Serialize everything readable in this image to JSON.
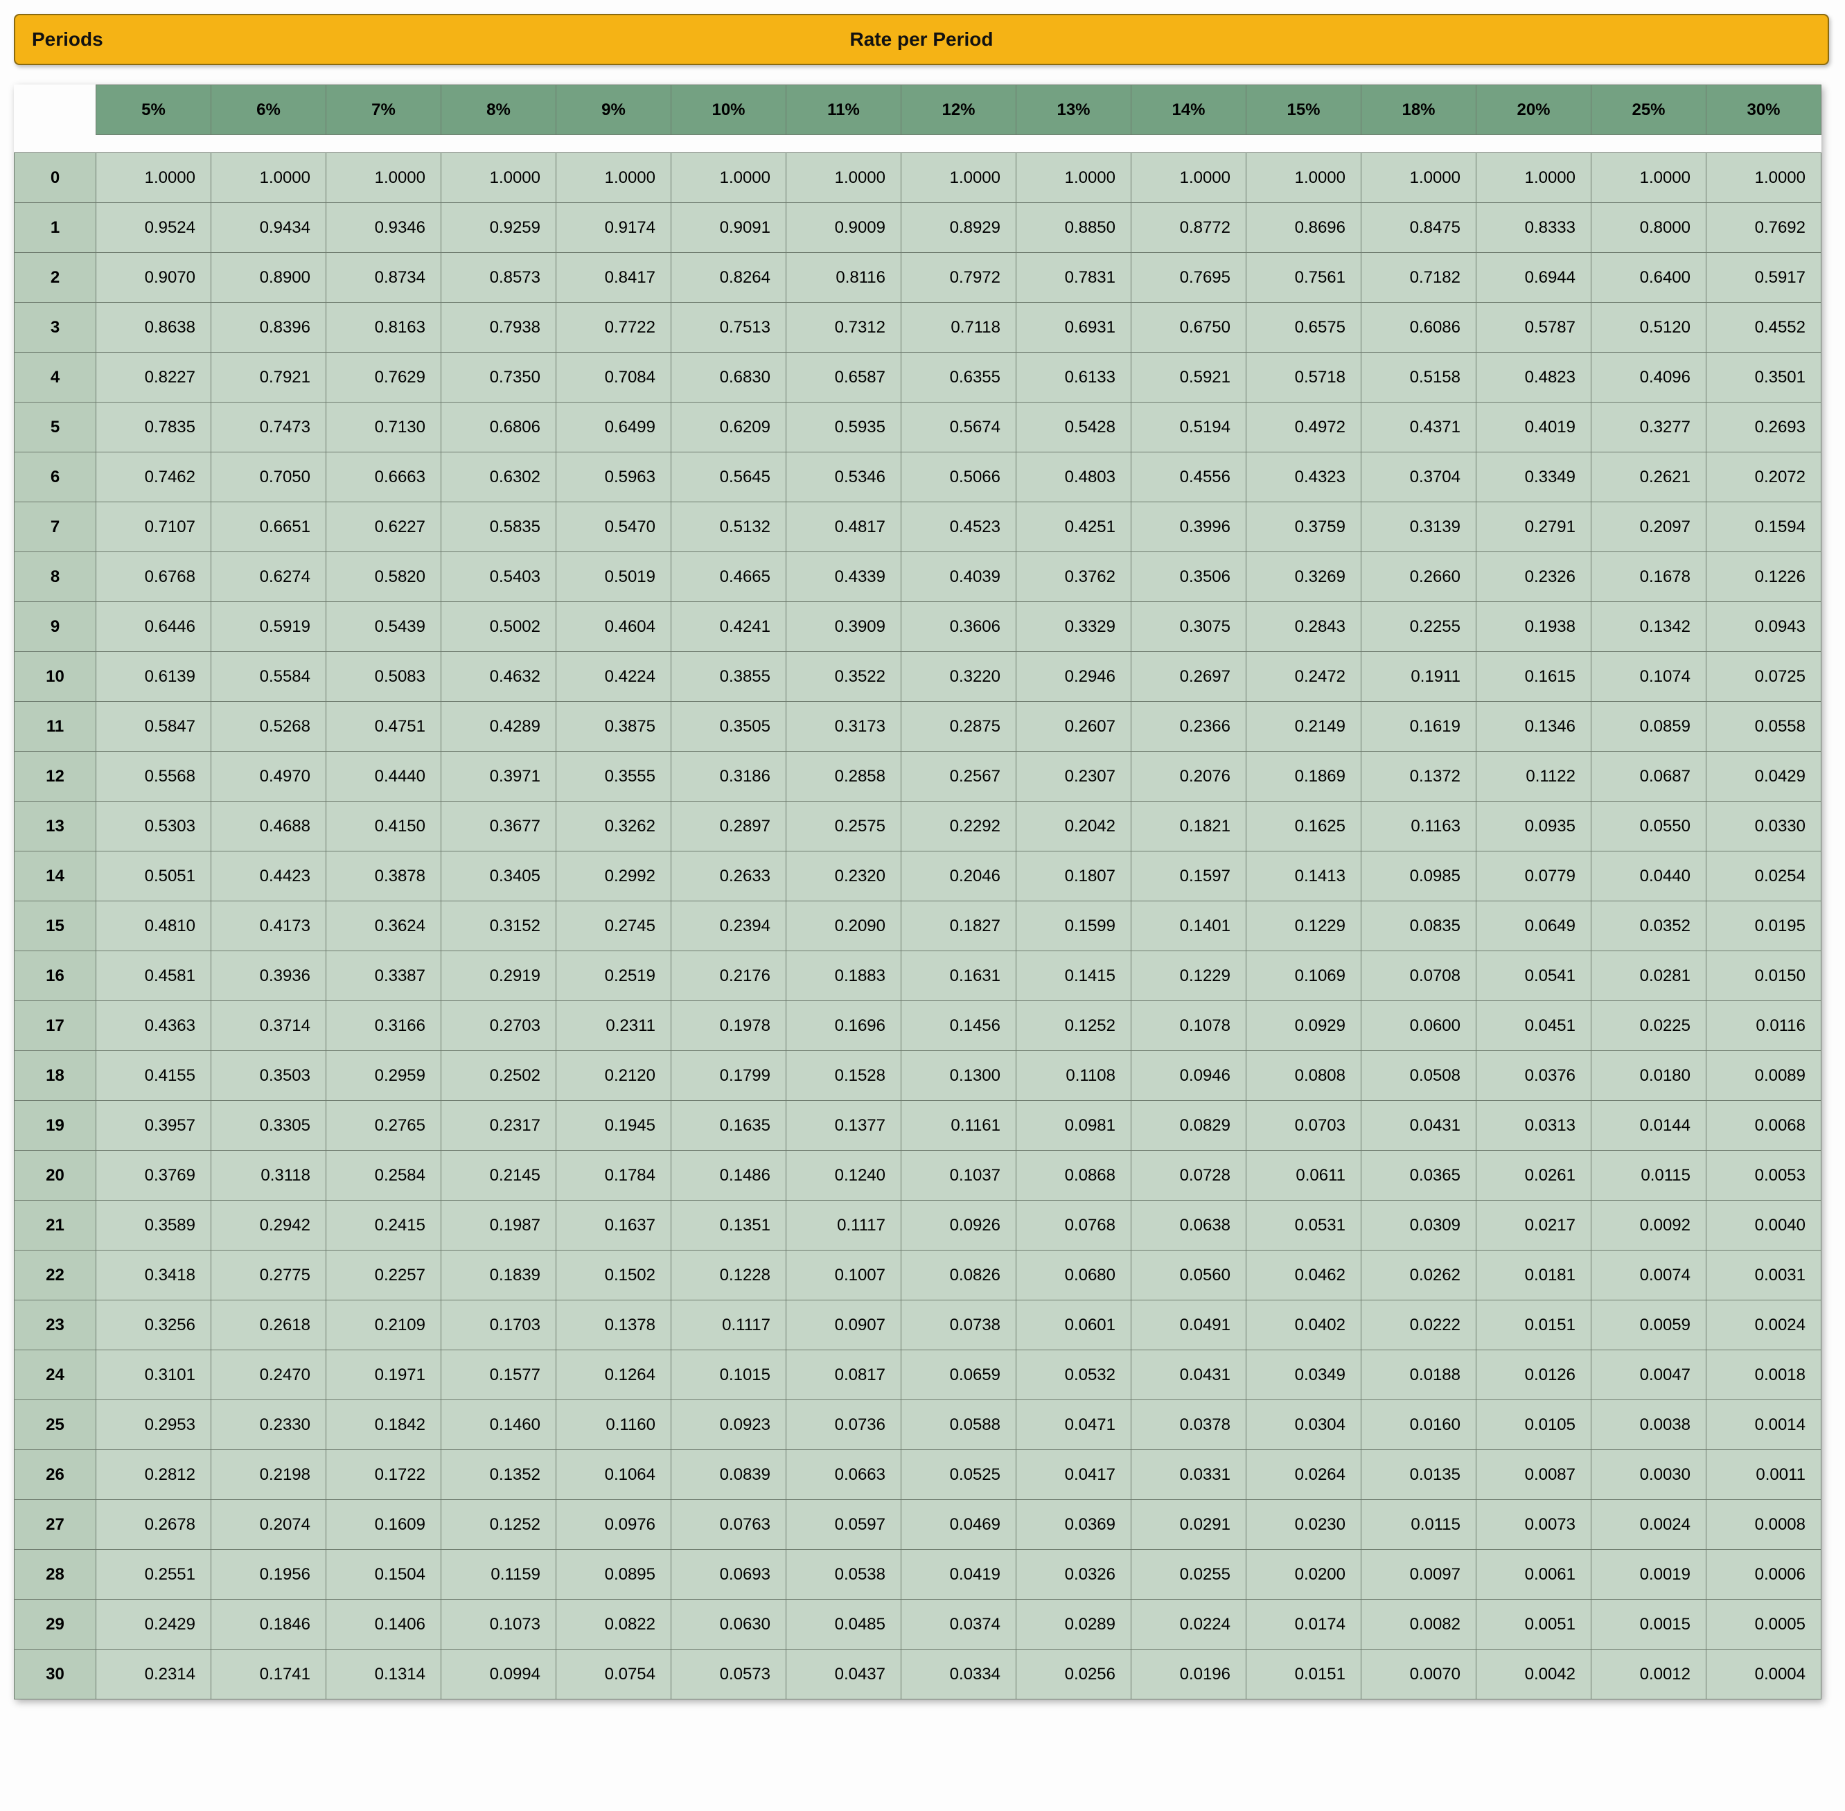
{
  "header": {
    "left": "Periods",
    "center": "Rate per Period"
  },
  "chart_data": {
    "type": "table",
    "title": "Present Value Factor Table",
    "columns": [
      "5%",
      "6%",
      "7%",
      "8%",
      "9%",
      "10%",
      "11%",
      "12%",
      "13%",
      "14%",
      "15%",
      "18%",
      "20%",
      "25%",
      "30%"
    ],
    "row_labels": [
      "0",
      "1",
      "2",
      "3",
      "4",
      "5",
      "6",
      "7",
      "8",
      "9",
      "10",
      "11",
      "12",
      "13",
      "14",
      "15",
      "16",
      "17",
      "18",
      "19",
      "20",
      "21",
      "22",
      "23",
      "24",
      "25",
      "26",
      "27",
      "28",
      "29",
      "30"
    ],
    "values": [
      [
        "1.0000",
        "1.0000",
        "1.0000",
        "1.0000",
        "1.0000",
        "1.0000",
        "1.0000",
        "1.0000",
        "1.0000",
        "1.0000",
        "1.0000",
        "1.0000",
        "1.0000",
        "1.0000",
        "1.0000"
      ],
      [
        "0.9524",
        "0.9434",
        "0.9346",
        "0.9259",
        "0.9174",
        "0.9091",
        "0.9009",
        "0.8929",
        "0.8850",
        "0.8772",
        "0.8696",
        "0.8475",
        "0.8333",
        "0.8000",
        "0.7692"
      ],
      [
        "0.9070",
        "0.8900",
        "0.8734",
        "0.8573",
        "0.8417",
        "0.8264",
        "0.8116",
        "0.7972",
        "0.7831",
        "0.7695",
        "0.7561",
        "0.7182",
        "0.6944",
        "0.6400",
        "0.5917"
      ],
      [
        "0.8638",
        "0.8396",
        "0.8163",
        "0.7938",
        "0.7722",
        "0.7513",
        "0.7312",
        "0.7118",
        "0.6931",
        "0.6750",
        "0.6575",
        "0.6086",
        "0.5787",
        "0.5120",
        "0.4552"
      ],
      [
        "0.8227",
        "0.7921",
        "0.7629",
        "0.7350",
        "0.7084",
        "0.6830",
        "0.6587",
        "0.6355",
        "0.6133",
        "0.5921",
        "0.5718",
        "0.5158",
        "0.4823",
        "0.4096",
        "0.3501"
      ],
      [
        "0.7835",
        "0.7473",
        "0.7130",
        "0.6806",
        "0.6499",
        "0.6209",
        "0.5935",
        "0.5674",
        "0.5428",
        "0.5194",
        "0.4972",
        "0.4371",
        "0.4019",
        "0.3277",
        "0.2693"
      ],
      [
        "0.7462",
        "0.7050",
        "0.6663",
        "0.6302",
        "0.5963",
        "0.5645",
        "0.5346",
        "0.5066",
        "0.4803",
        "0.4556",
        "0.4323",
        "0.3704",
        "0.3349",
        "0.2621",
        "0.2072"
      ],
      [
        "0.7107",
        "0.6651",
        "0.6227",
        "0.5835",
        "0.5470",
        "0.5132",
        "0.4817",
        "0.4523",
        "0.4251",
        "0.3996",
        "0.3759",
        "0.3139",
        "0.2791",
        "0.2097",
        "0.1594"
      ],
      [
        "0.6768",
        "0.6274",
        "0.5820",
        "0.5403",
        "0.5019",
        "0.4665",
        "0.4339",
        "0.4039",
        "0.3762",
        "0.3506",
        "0.3269",
        "0.2660",
        "0.2326",
        "0.1678",
        "0.1226"
      ],
      [
        "0.6446",
        "0.5919",
        "0.5439",
        "0.5002",
        "0.4604",
        "0.4241",
        "0.3909",
        "0.3606",
        "0.3329",
        "0.3075",
        "0.2843",
        "0.2255",
        "0.1938",
        "0.1342",
        "0.0943"
      ],
      [
        "0.6139",
        "0.5584",
        "0.5083",
        "0.4632",
        "0.4224",
        "0.3855",
        "0.3522",
        "0.3220",
        "0.2946",
        "0.2697",
        "0.2472",
        "0.1911",
        "0.1615",
        "0.1074",
        "0.0725"
      ],
      [
        "0.5847",
        "0.5268",
        "0.4751",
        "0.4289",
        "0.3875",
        "0.3505",
        "0.3173",
        "0.2875",
        "0.2607",
        "0.2366",
        "0.2149",
        "0.1619",
        "0.1346",
        "0.0859",
        "0.0558"
      ],
      [
        "0.5568",
        "0.4970",
        "0.4440",
        "0.3971",
        "0.3555",
        "0.3186",
        "0.2858",
        "0.2567",
        "0.2307",
        "0.2076",
        "0.1869",
        "0.1372",
        "0.1122",
        "0.0687",
        "0.0429"
      ],
      [
        "0.5303",
        "0.4688",
        "0.4150",
        "0.3677",
        "0.3262",
        "0.2897",
        "0.2575",
        "0.2292",
        "0.2042",
        "0.1821",
        "0.1625",
        "0.1163",
        "0.0935",
        "0.0550",
        "0.0330"
      ],
      [
        "0.5051",
        "0.4423",
        "0.3878",
        "0.3405",
        "0.2992",
        "0.2633",
        "0.2320",
        "0.2046",
        "0.1807",
        "0.1597",
        "0.1413",
        "0.0985",
        "0.0779",
        "0.0440",
        "0.0254"
      ],
      [
        "0.4810",
        "0.4173",
        "0.3624",
        "0.3152",
        "0.2745",
        "0.2394",
        "0.2090",
        "0.1827",
        "0.1599",
        "0.1401",
        "0.1229",
        "0.0835",
        "0.0649",
        "0.0352",
        "0.0195"
      ],
      [
        "0.4581",
        "0.3936",
        "0.3387",
        "0.2919",
        "0.2519",
        "0.2176",
        "0.1883",
        "0.1631",
        "0.1415",
        "0.1229",
        "0.1069",
        "0.0708",
        "0.0541",
        "0.0281",
        "0.0150"
      ],
      [
        "0.4363",
        "0.3714",
        "0.3166",
        "0.2703",
        "0.2311",
        "0.1978",
        "0.1696",
        "0.1456",
        "0.1252",
        "0.1078",
        "0.0929",
        "0.0600",
        "0.0451",
        "0.0225",
        "0.0116"
      ],
      [
        "0.4155",
        "0.3503",
        "0.2959",
        "0.2502",
        "0.2120",
        "0.1799",
        "0.1528",
        "0.1300",
        "0.1108",
        "0.0946",
        "0.0808",
        "0.0508",
        "0.0376",
        "0.0180",
        "0.0089"
      ],
      [
        "0.3957",
        "0.3305",
        "0.2765",
        "0.2317",
        "0.1945",
        "0.1635",
        "0.1377",
        "0.1161",
        "0.0981",
        "0.0829",
        "0.0703",
        "0.0431",
        "0.0313",
        "0.0144",
        "0.0068"
      ],
      [
        "0.3769",
        "0.3118",
        "0.2584",
        "0.2145",
        "0.1784",
        "0.1486",
        "0.1240",
        "0.1037",
        "0.0868",
        "0.0728",
        "0.0611",
        "0.0365",
        "0.0261",
        "0.0115",
        "0.0053"
      ],
      [
        "0.3589",
        "0.2942",
        "0.2415",
        "0.1987",
        "0.1637",
        "0.1351",
        "0.1117",
        "0.0926",
        "0.0768",
        "0.0638",
        "0.0531",
        "0.0309",
        "0.0217",
        "0.0092",
        "0.0040"
      ],
      [
        "0.3418",
        "0.2775",
        "0.2257",
        "0.1839",
        "0.1502",
        "0.1228",
        "0.1007",
        "0.0826",
        "0.0680",
        "0.0560",
        "0.0462",
        "0.0262",
        "0.0181",
        "0.0074",
        "0.0031"
      ],
      [
        "0.3256",
        "0.2618",
        "0.2109",
        "0.1703",
        "0.1378",
        "0.1117",
        "0.0907",
        "0.0738",
        "0.0601",
        "0.0491",
        "0.0402",
        "0.0222",
        "0.0151",
        "0.0059",
        "0.0024"
      ],
      [
        "0.3101",
        "0.2470",
        "0.1971",
        "0.1577",
        "0.1264",
        "0.1015",
        "0.0817",
        "0.0659",
        "0.0532",
        "0.0431",
        "0.0349",
        "0.0188",
        "0.0126",
        "0.0047",
        "0.0018"
      ],
      [
        "0.2953",
        "0.2330",
        "0.1842",
        "0.1460",
        "0.1160",
        "0.0923",
        "0.0736",
        "0.0588",
        "0.0471",
        "0.0378",
        "0.0304",
        "0.0160",
        "0.0105",
        "0.0038",
        "0.0014"
      ],
      [
        "0.2812",
        "0.2198",
        "0.1722",
        "0.1352",
        "0.1064",
        "0.0839",
        "0.0663",
        "0.0525",
        "0.0417",
        "0.0331",
        "0.0264",
        "0.0135",
        "0.0087",
        "0.0030",
        "0.0011"
      ],
      [
        "0.2678",
        "0.2074",
        "0.1609",
        "0.1252",
        "0.0976",
        "0.0763",
        "0.0597",
        "0.0469",
        "0.0369",
        "0.0291",
        "0.0230",
        "0.0115",
        "0.0073",
        "0.0024",
        "0.0008"
      ],
      [
        "0.2551",
        "0.1956",
        "0.1504",
        "0.1159",
        "0.0895",
        "0.0693",
        "0.0538",
        "0.0419",
        "0.0326",
        "0.0255",
        "0.0200",
        "0.0097",
        "0.0061",
        "0.0019",
        "0.0006"
      ],
      [
        "0.2429",
        "0.1846",
        "0.1406",
        "0.1073",
        "0.0822",
        "0.0630",
        "0.0485",
        "0.0374",
        "0.0289",
        "0.0224",
        "0.0174",
        "0.0082",
        "0.0051",
        "0.0015",
        "0.0005"
      ],
      [
        "0.2314",
        "0.1741",
        "0.1314",
        "0.0994",
        "0.0754",
        "0.0573",
        "0.0437",
        "0.0334",
        "0.0256",
        "0.0196",
        "0.0151",
        "0.0070",
        "0.0042",
        "0.0012",
        "0.0004"
      ]
    ]
  }
}
